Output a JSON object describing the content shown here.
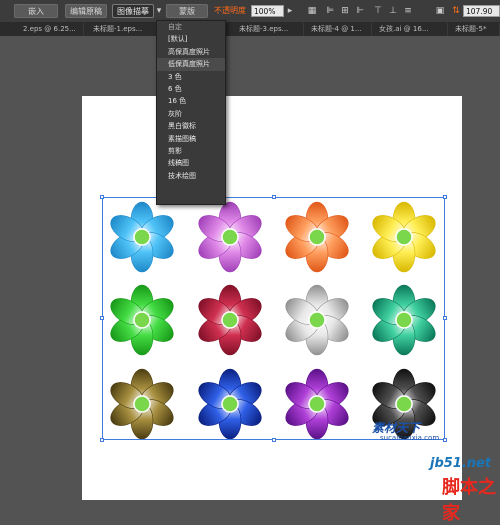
{
  "toolbar": {
    "embed_label": "嵌入",
    "edit_original_label": "编辑原稿",
    "image_trace_label": "图像描摹",
    "mask_label": "蒙版",
    "opacity_label": "不透明度",
    "opacity_value": "100%",
    "zoom_value": "107.90"
  },
  "tabs": [
    "2.eps @ 6.25...",
    "未标题-1.eps...",
    "未标题-3.eps...",
    "未标题-4 @ 1...",
    "女孩.ai @ 16...",
    "未标题-5*"
  ],
  "menu": {
    "items": [
      "自定",
      "[默认]",
      "高保真度照片",
      "低保真度照片",
      "3 色",
      "6 色",
      "16 色",
      "灰阶",
      "黑白徽标",
      "素描图稿",
      "剪影",
      "线稿图",
      "技术绘图"
    ],
    "highlighted_index": 3
  },
  "flowers": [
    {
      "petal": "#4fc3f7",
      "petal_dark": "#1e88c8"
    },
    {
      "petal": "#e08ae8",
      "petal_dark": "#a040b8"
    },
    {
      "petal": "#ffa060",
      "petal_dark": "#e05818"
    },
    {
      "petal": "#ffee55",
      "petal_dark": "#d8b800"
    },
    {
      "petal": "#44dd44",
      "petal_dark": "#189818"
    },
    {
      "petal": "#d03050",
      "petal_dark": "#801028"
    },
    {
      "petal": "#e8e8e8",
      "petal_dark": "#909090"
    },
    {
      "petal": "#40d0a0",
      "petal_dark": "#0a7858"
    },
    {
      "petal": "#a89040",
      "petal_dark": "#4a3c10"
    },
    {
      "petal": "#3060e8",
      "petal_dark": "#0a2080"
    },
    {
      "petal": "#b040d8",
      "petal_dark": "#5a1088"
    },
    {
      "petal": "#505050",
      "petal_dark": "#101010"
    }
  ],
  "watermark": {
    "logo_text": "素材天下",
    "site": "sucaitianxia.com",
    "jb51": "jb51.net",
    "jiaoben": "脚本之家"
  },
  "colors": {
    "toolbar_bg": "#3c3c3c",
    "canvas_bg": "#535353",
    "selection": "#3e7bdc",
    "opacity_label": "#ff6a1a",
    "flower_center": "#7ad64a"
  }
}
